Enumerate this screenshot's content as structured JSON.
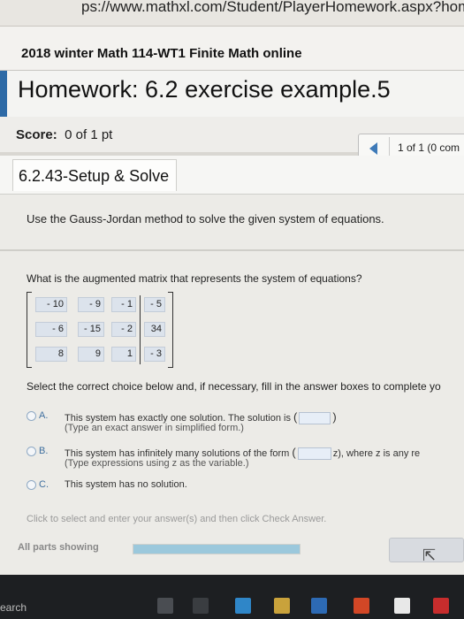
{
  "browser": {
    "url_text": "ps://www.mathxl.com/Student/PlayerHomework.aspx?homeworkId"
  },
  "course": {
    "title": "2018 winter Math 114-WT1 Finite Math online"
  },
  "homework": {
    "title": "Homework: 6.2 exercise example.5"
  },
  "score": {
    "label": "Score:",
    "value": "0 of 1 pt"
  },
  "pager": {
    "count_text": "1 of 1 (0 com"
  },
  "exercise": {
    "id": "6.2.43-Setup & Solve"
  },
  "problem": {
    "instruction": "Use the Gauss-Jordan method to solve the given system of equations.",
    "question": "What is the augmented matrix that represents the system of equations?",
    "matrix": [
      [
        "- 10",
        "- 9",
        "- 1",
        "- 5"
      ],
      [
        "- 6",
        "- 15",
        "- 2",
        "34"
      ],
      [
        "8",
        "9",
        "1",
        "- 3"
      ]
    ],
    "choice_prompt": "Select the correct choice below and, if necessary, fill in the answer boxes to complete yo",
    "choices": [
      {
        "letter": "A.",
        "text": "This system has exactly one solution. The solution is",
        "hint": "(Type an exact answer in simplified form.)"
      },
      {
        "letter": "B.",
        "text": "This system has infinitely many solutions of the form",
        "after": "z), where z is any re",
        "hint": "(Type expressions using z as the variable.)"
      },
      {
        "letter": "C.",
        "text": "This system has no solution."
      }
    ]
  },
  "footer": {
    "instruction": "Click to select and enter your answer(s) and then click Check Answer.",
    "parts_label": "All parts showing",
    "progress": 1.0
  },
  "taskbar": {
    "search_text": "earch"
  }
}
